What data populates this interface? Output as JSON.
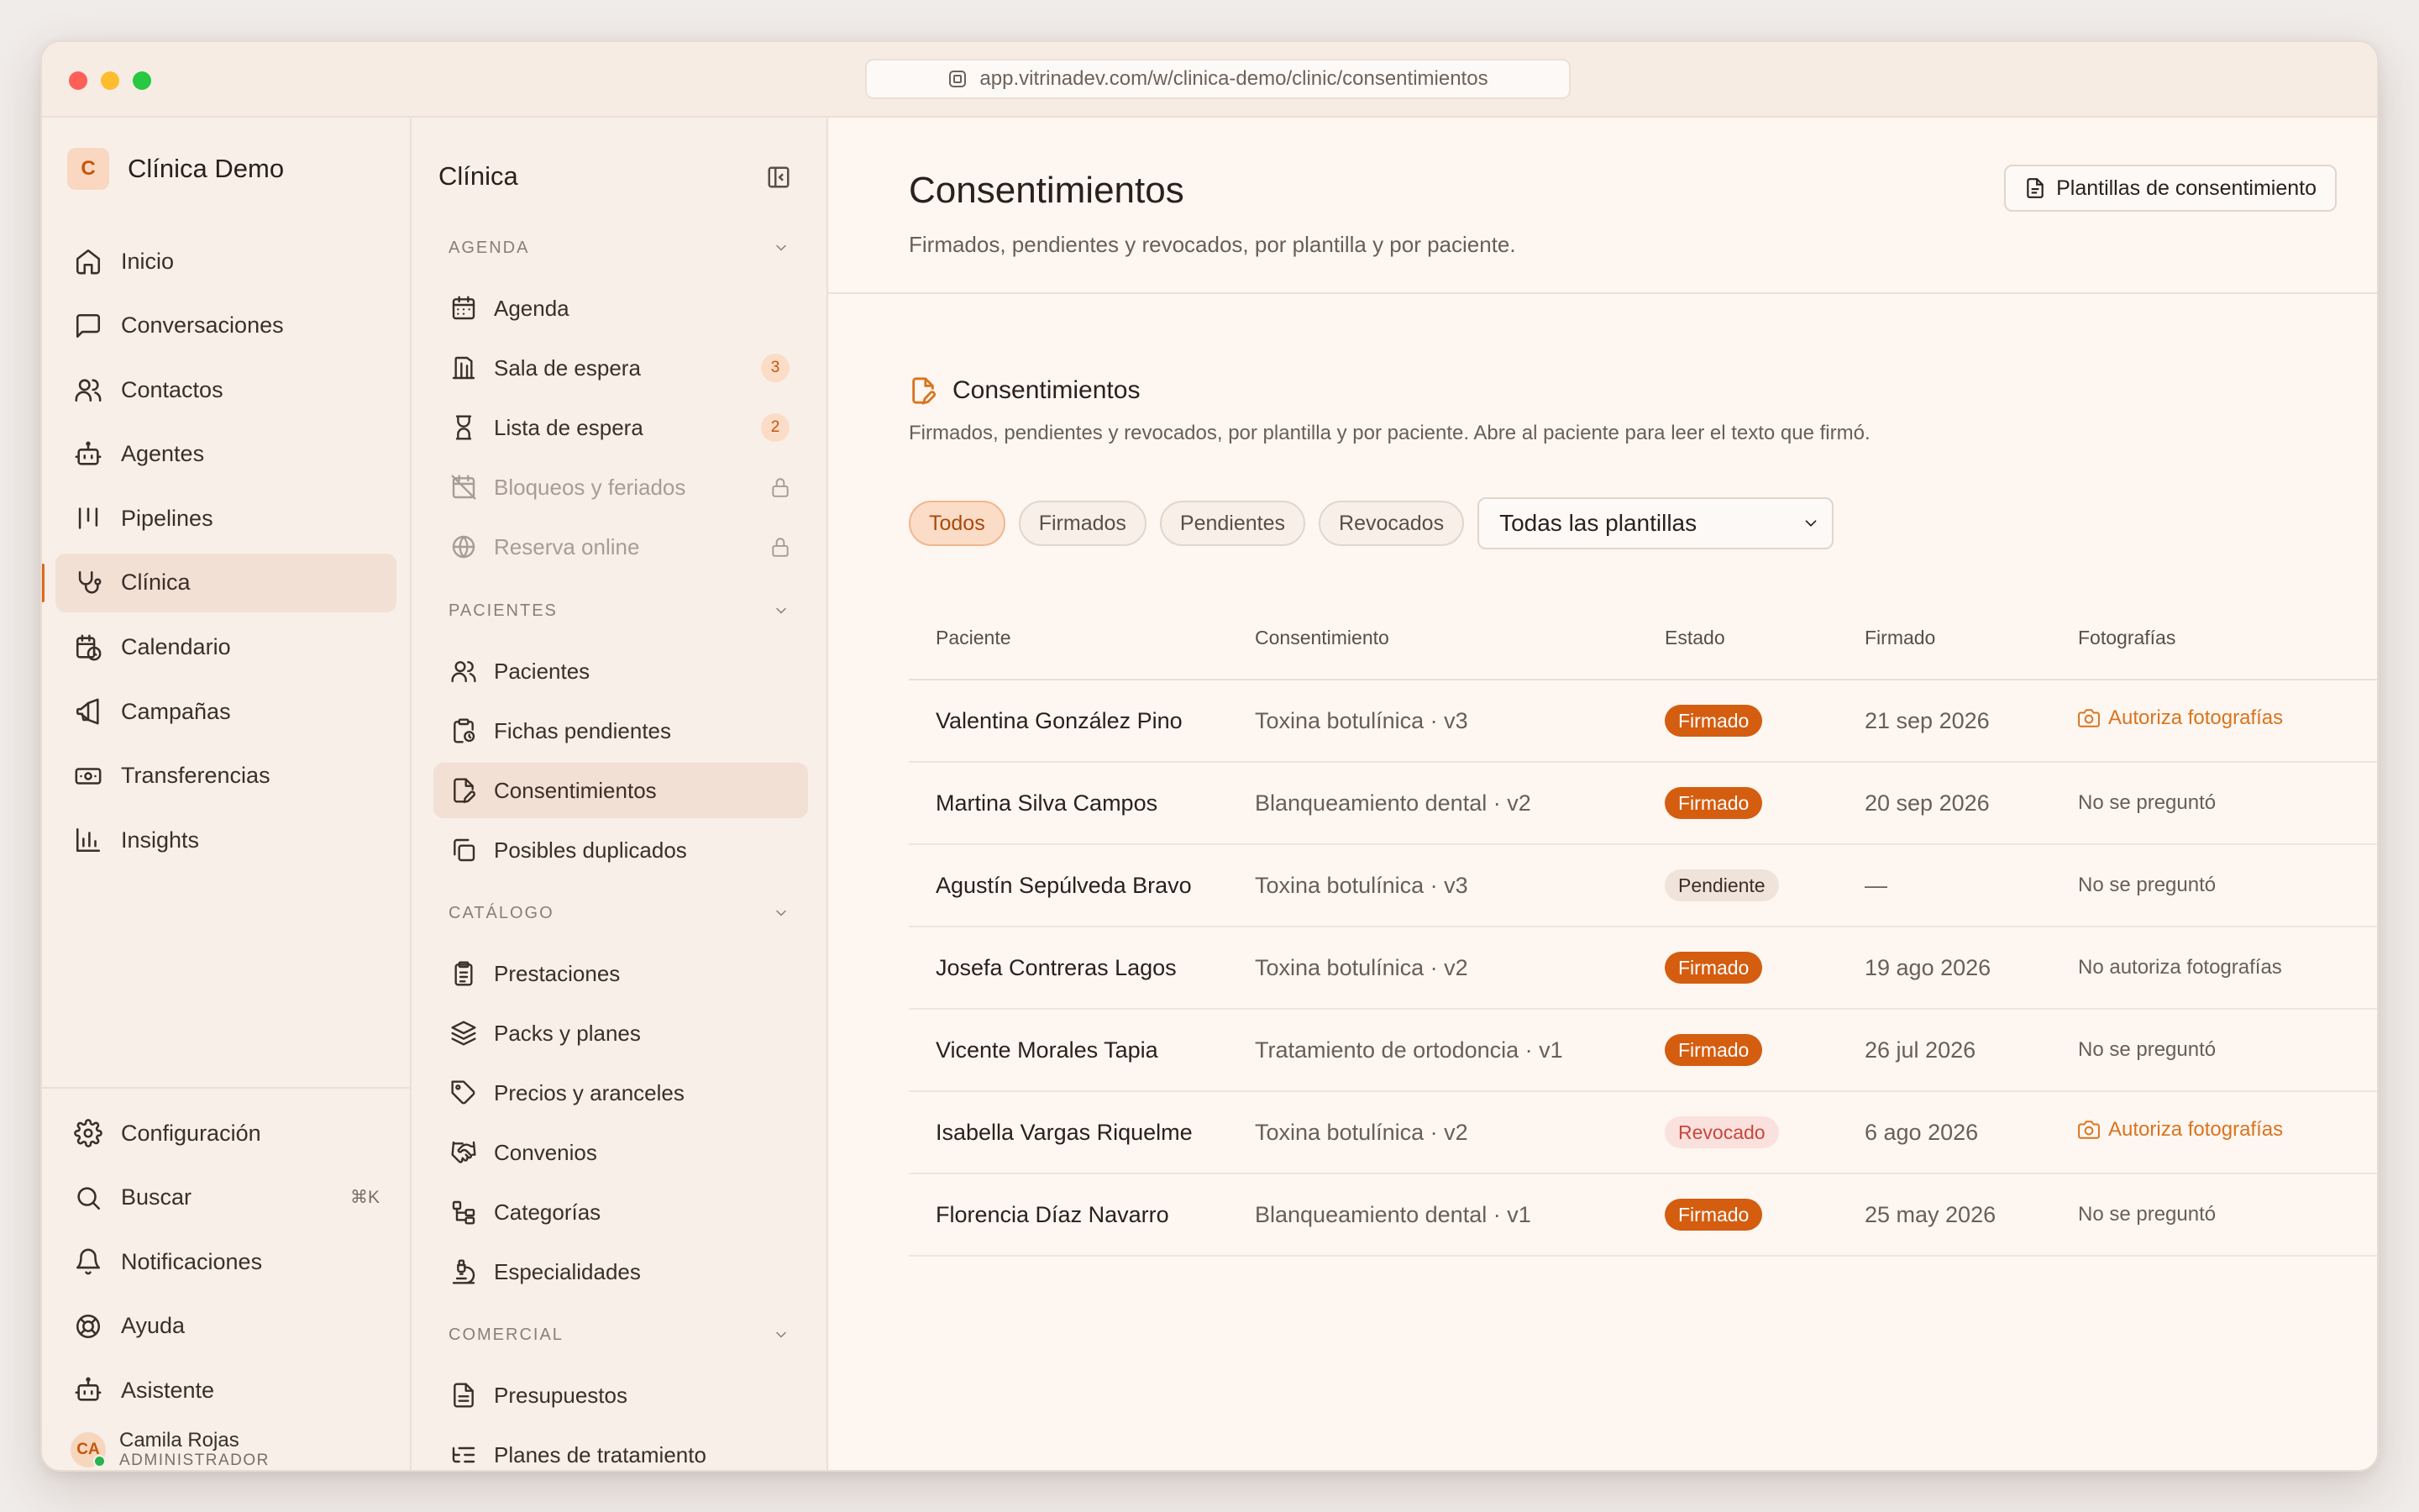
{
  "browser": {
    "url": "app.vitrinadev.com/w/clinica-demo/clinic/consentimientos"
  },
  "brand": {
    "initial": "C",
    "name": "Clínica Demo"
  },
  "main_nav": [
    {
      "label": "Inicio",
      "icon": "home-icon"
    },
    {
      "label": "Conversaciones",
      "icon": "chat-icon"
    },
    {
      "label": "Contactos",
      "icon": "users-icon"
    },
    {
      "label": "Agentes",
      "icon": "bot-icon"
    },
    {
      "label": "Pipelines",
      "icon": "pipeline-icon"
    },
    {
      "label": "Clínica",
      "icon": "stethoscope-icon",
      "active": true
    },
    {
      "label": "Calendario",
      "icon": "calendar-clock-icon"
    },
    {
      "label": "Campañas",
      "icon": "megaphone-icon"
    },
    {
      "label": "Transferencias",
      "icon": "banknote-icon"
    },
    {
      "label": "Insights",
      "icon": "bar-chart-icon"
    }
  ],
  "bottom_nav": [
    {
      "label": "Configuración",
      "icon": "gear-icon"
    },
    {
      "label": "Buscar",
      "icon": "search-icon",
      "shortcut": "⌘K"
    },
    {
      "label": "Notificaciones",
      "icon": "bell-icon"
    },
    {
      "label": "Ayuda",
      "icon": "lifebuoy-icon"
    },
    {
      "label": "Asistente",
      "icon": "bot-icon"
    }
  ],
  "user": {
    "initials": "CA",
    "name": "Camila Rojas",
    "role": "ADMINISTRADOR"
  },
  "section_nav": {
    "title": "Clínica",
    "groups": [
      {
        "label": "AGENDA",
        "items": [
          {
            "label": "Agenda",
            "icon": "calendar-icon"
          },
          {
            "label": "Sala de espera",
            "icon": "building-icon",
            "count": "3"
          },
          {
            "label": "Lista de espera",
            "icon": "hourglass-icon",
            "count": "2"
          },
          {
            "label": "Bloqueos y feriados",
            "icon": "calendar-off-icon",
            "locked": true
          },
          {
            "label": "Reserva online",
            "icon": "globe-icon",
            "locked": true
          }
        ]
      },
      {
        "label": "PACIENTES",
        "items": [
          {
            "label": "Pacientes",
            "icon": "users-icon"
          },
          {
            "label": "Fichas pendientes",
            "icon": "clipboard-clock-icon"
          },
          {
            "label": "Consentimientos",
            "icon": "file-pen-icon",
            "active": true
          },
          {
            "label": "Posibles duplicados",
            "icon": "copy-icon"
          }
        ]
      },
      {
        "label": "CATÁLOGO",
        "items": [
          {
            "label": "Prestaciones",
            "icon": "clipboard-list-icon"
          },
          {
            "label": "Packs y planes",
            "icon": "layers-icon"
          },
          {
            "label": "Precios y aranceles",
            "icon": "tag-icon"
          },
          {
            "label": "Convenios",
            "icon": "handshake-icon"
          },
          {
            "label": "Categorías",
            "icon": "tree-icon"
          },
          {
            "label": "Especialidades",
            "icon": "microscope-icon"
          }
        ]
      },
      {
        "label": "COMERCIAL",
        "items": [
          {
            "label": "Presupuestos",
            "icon": "file-text-icon"
          },
          {
            "label": "Planes de tratamiento",
            "icon": "list-tree-icon"
          }
        ]
      }
    ]
  },
  "page": {
    "title": "Consentimientos",
    "subtitle": "Firmados, pendientes y revocados, por plantilla y por paciente.",
    "templates_button": "Plantillas de consentimiento",
    "card_title": "Consentimientos",
    "card_description": "Firmados, pendientes y revocados, por plantilla y por paciente. Abre al paciente para leer el texto que firmó.",
    "filters": [
      "Todos",
      "Firmados",
      "Pendientes",
      "Revocados"
    ],
    "active_filter": "Todos",
    "template_select": "Todas las plantillas"
  },
  "table": {
    "columns": [
      "Paciente",
      "Consentimiento",
      "Estado",
      "Firmado",
      "Fotografías"
    ],
    "rows": [
      {
        "patient": "Valentina González Pino",
        "consent": "Toxina botulínica · v3",
        "status": "Firmado",
        "signed": "21 sep 2026",
        "photos": "Autoriza fotografías",
        "photo_link": true
      },
      {
        "patient": "Martina Silva Campos",
        "consent": "Blanqueamiento dental · v2",
        "status": "Firmado",
        "signed": "20 sep 2026",
        "photos": "No se preguntó"
      },
      {
        "patient": "Agustín Sepúlveda Bravo",
        "consent": "Toxina botulínica · v3",
        "status": "Pendiente",
        "signed": "—",
        "photos": "No se preguntó"
      },
      {
        "patient": "Josefa Contreras Lagos",
        "consent": "Toxina botulínica · v2",
        "status": "Firmado",
        "signed": "19 ago 2026",
        "photos": "No autoriza fotografías"
      },
      {
        "patient": "Vicente Morales Tapia",
        "consent": "Tratamiento de ortodoncia · v1",
        "status": "Firmado",
        "signed": "26 jul 2026",
        "photos": "No se preguntó"
      },
      {
        "patient": "Isabella Vargas Riquelme",
        "consent": "Toxina botulínica · v2",
        "status": "Revocado",
        "signed": "6 ago 2026",
        "photos": "Autoriza fotografías",
        "photo_link": true
      },
      {
        "patient": "Florencia Díaz Navarro",
        "consent": "Blanqueamiento dental · v1",
        "status": "Firmado",
        "signed": "25 may 2026",
        "photos": "No se preguntó"
      }
    ]
  },
  "colors": {
    "accent": "#d45d10",
    "link": "#d9741e",
    "revoked": "#c8473b",
    "background": "#fdf6f1",
    "sidebar": "#f8efe9"
  }
}
